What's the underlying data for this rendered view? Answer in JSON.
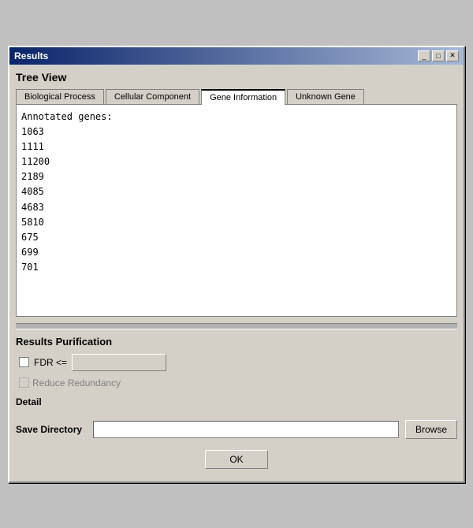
{
  "window": {
    "title": "Results",
    "title_icon": "results-icon"
  },
  "title_buttons": {
    "minimize": "_",
    "maximize": "□",
    "close": "✕"
  },
  "tree_view": {
    "label": "Tree View"
  },
  "tabs": [
    {
      "id": "biological-process",
      "label": "Biological Process",
      "active": false
    },
    {
      "id": "cellular-component",
      "label": "Cellular Component",
      "active": false
    },
    {
      "id": "gene-information",
      "label": "Gene Information",
      "active": true
    },
    {
      "id": "unknown-gene",
      "label": "Unknown Gene",
      "active": false
    }
  ],
  "gene_content": {
    "header": "Annotated genes:",
    "genes": [
      "1063",
      "1111",
      "11200",
      "2189",
      "4085",
      "4683",
      "5810",
      "675",
      "699",
      "701"
    ]
  },
  "purification": {
    "label": "Results Purification",
    "fdr_label": "FDR <=",
    "reduce_label": "Reduce Redundancy",
    "detail_label": "Detail"
  },
  "save": {
    "label": "Save Directory",
    "placeholder": "",
    "browse_label": "Browse"
  },
  "ok_label": "OK"
}
